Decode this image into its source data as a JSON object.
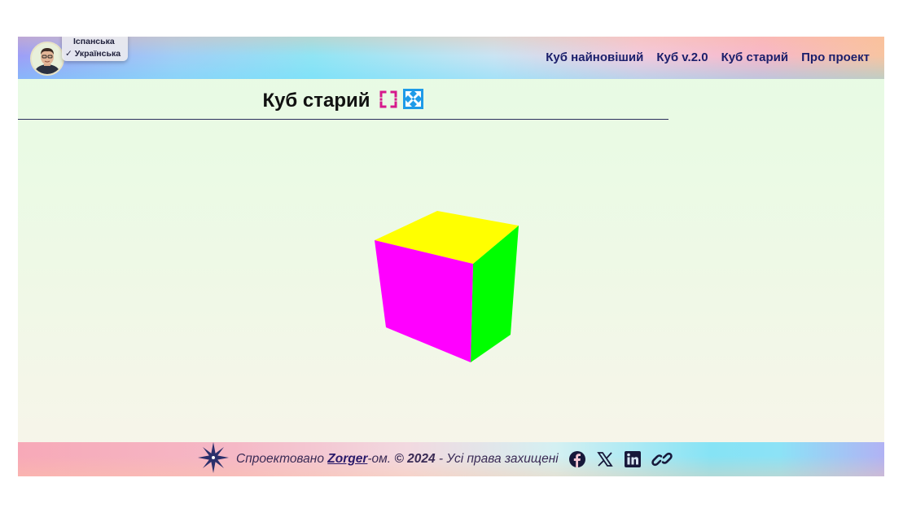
{
  "header": {
    "language_menu": {
      "items": [
        {
          "label": "Іспанська"
        },
        {
          "label": "✓ Українська"
        }
      ]
    },
    "nav": [
      {
        "label": "Куб найновіший"
      },
      {
        "label": "Куб v.2.0"
      },
      {
        "label": "Куб старий"
      },
      {
        "label": "Про проект"
      }
    ]
  },
  "main": {
    "title": "Куб старий",
    "cube_faces": {
      "top": "#ffff00",
      "front": "#ff00ff",
      "right": "#00ff00"
    }
  },
  "footer": {
    "designed_prefix": "Спроектовано ",
    "author": "Zorger",
    "designed_suffix": "-ом. ",
    "copyright": "© 2024",
    "rights": " - Усі права захищені",
    "social": [
      "facebook-icon",
      "x-icon",
      "linkedin-icon",
      "link-icon"
    ]
  },
  "colors": {
    "nav_text": "#1b1f6b",
    "fullscreen_icon": "#d6198c",
    "expand_icon": "#1e9be8"
  }
}
